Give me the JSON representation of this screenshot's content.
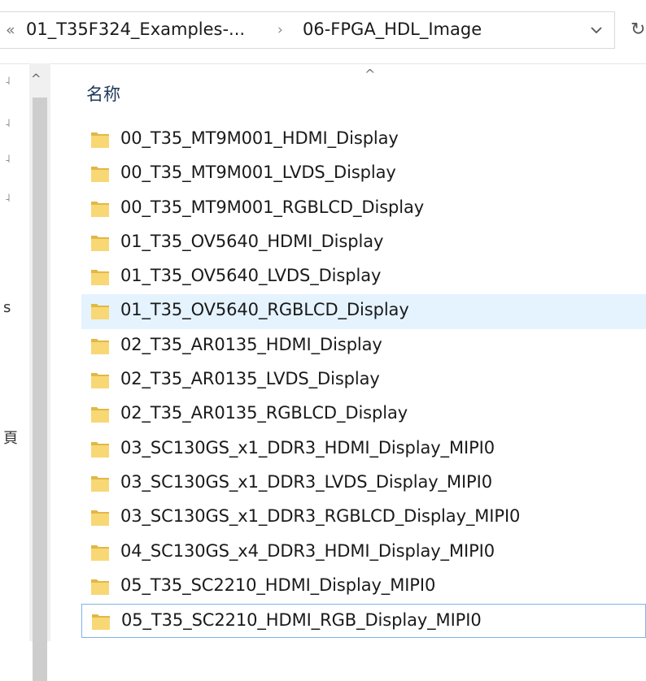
{
  "address_bar": {
    "breadcrumbs": [
      "01_T35F324_Examples-...",
      "06-FPGA_HDL_Image"
    ],
    "overflow_glyph": "«",
    "separator_glyph": "›",
    "refresh_glyph": "↻"
  },
  "nav_pane": {
    "scroll_up_glyph": "^",
    "pin_glyph": "˨",
    "fragments": [
      "s",
      "頁"
    ]
  },
  "file_list": {
    "column_header": "名称",
    "sort_glyph": "^",
    "items": [
      "00_T35_MT9M001_HDMI_Display",
      "00_T35_MT9M001_LVDS_Display",
      "00_T35_MT9M001_RGBLCD_Display",
      "01_T35_OV5640_HDMI_Display",
      "01_T35_OV5640_LVDS_Display",
      "01_T35_OV5640_RGBLCD_Display",
      "02_T35_AR0135_HDMI_Display",
      "02_T35_AR0135_LVDS_Display",
      "02_T35_AR0135_RGBLCD_Display",
      "03_SC130GS_x1_DDR3_HDMI_Display_MIPI0",
      "03_SC130GS_x1_DDR3_LVDS_Display_MIPI0",
      "03_SC130GS_x1_DDR3_RGBLCD_Display_MIPI0",
      "04_SC130GS_x4_DDR3_HDMI_Display_MIPI0",
      "05_T35_SC2210_HDMI_Display_MIPI0",
      "05_T35_SC2210_HDMI_RGB_Display_MIPI0"
    ],
    "hover_index": 5,
    "focused_index": 14
  },
  "colors": {
    "hover_bg": "#e5f3ff",
    "focus_border": "#7fb3e6",
    "folder_fill": "#f8d775",
    "folder_dark": "#e0b845"
  }
}
